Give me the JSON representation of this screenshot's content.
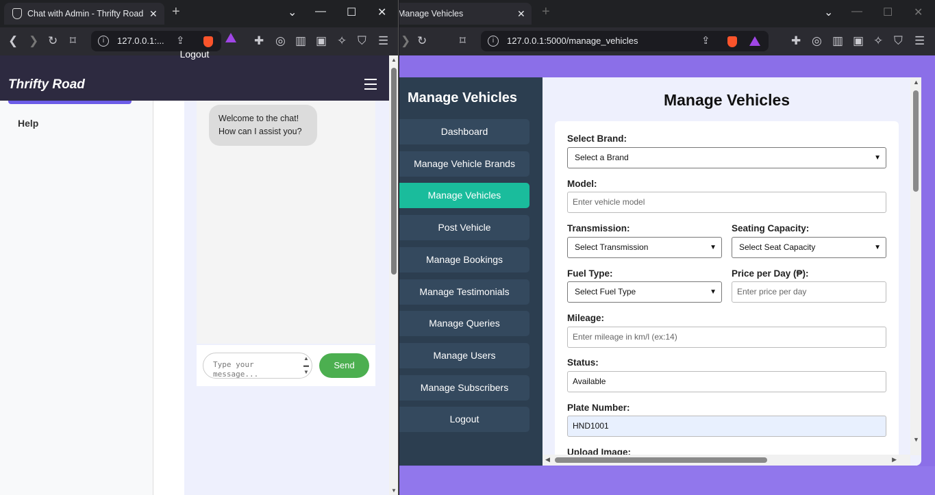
{
  "left_window": {
    "tab_title": "Chat with Admin - Thrifty Road",
    "url": "127.0.0.1:...",
    "page": {
      "logout_label": "Logout",
      "brand": "Thrifty Road",
      "sidebar": {
        "help_label": "Help"
      },
      "chat": {
        "welcome_line1": "Welcome to the chat!",
        "welcome_line2": "How can I assist you?",
        "input_placeholder_line1": "Type your",
        "input_placeholder_line2": "message...",
        "send_label": "Send"
      }
    }
  },
  "right_window": {
    "tab_title": "Manage Vehicles",
    "url": "127.0.0.1:5000/manage_vehicles",
    "page": {
      "sidebar_title": "Manage Vehicles",
      "nav": [
        {
          "label": "Dashboard"
        },
        {
          "label": "Manage Vehicle Brands"
        },
        {
          "label": "Manage Vehicles",
          "active": true
        },
        {
          "label": "Post Vehicle"
        },
        {
          "label": "Manage Bookings"
        },
        {
          "label": "Manage Testimonials"
        },
        {
          "label": "Manage Queries"
        },
        {
          "label": "Manage Users"
        },
        {
          "label": "Manage Subscribers"
        },
        {
          "label": "Logout"
        }
      ],
      "title": "Manage Vehicles",
      "form": {
        "brand_label": "Select Brand:",
        "brand_value": "Select a Brand",
        "model_label": "Model:",
        "model_placeholder": "Enter vehicle model",
        "transmission_label": "Transmission:",
        "transmission_value": "Select Transmission",
        "seating_label": "Seating Capacity:",
        "seating_value": "Select Seat Capacity",
        "fuel_label": "Fuel Type:",
        "fuel_value": "Select Fuel Type",
        "price_label": "Price per Day (₱):",
        "price_placeholder": "Enter price per day",
        "mileage_label": "Mileage:",
        "mileage_placeholder": "Enter mileage in km/l (ex:14)",
        "status_label": "Status:",
        "status_value": "Available",
        "plate_label": "Plate Number:",
        "plate_value": "HND1001",
        "upload_label": "Upload Image:"
      }
    }
  },
  "colors": {
    "sidebar_bg": "#2c3e50",
    "nav_btn": "#34495e",
    "nav_active": "#1abc9c",
    "send_button": "#4caf50",
    "page_bg_purple": "#8b6fe8",
    "left_navbar": "#2d2a40"
  }
}
